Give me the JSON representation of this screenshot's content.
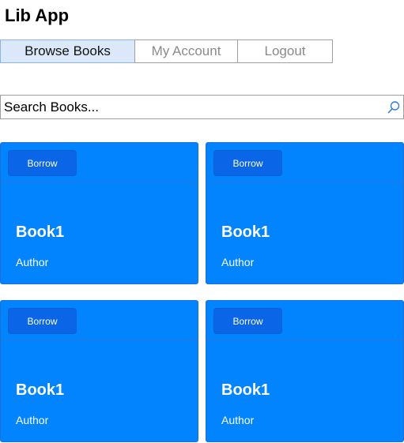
{
  "app": {
    "title": "Lib App"
  },
  "nav": {
    "tabs": [
      {
        "label": "Browse Books",
        "active": true
      },
      {
        "label": "My Account",
        "active": false
      },
      {
        "label": "Logout",
        "active": false
      }
    ]
  },
  "search": {
    "placeholder": "Search Books...",
    "value": "",
    "icon": "search-icon"
  },
  "books": [
    {
      "title": "Book1",
      "author": "Author",
      "action_label": "Borrow"
    },
    {
      "title": "Book1",
      "author": "Author",
      "action_label": "Borrow"
    },
    {
      "title": "Book1",
      "author": "Author",
      "action_label": "Borrow"
    },
    {
      "title": "Book1",
      "author": "Author",
      "action_label": "Borrow"
    }
  ],
  "colors": {
    "card_background": "#0384ff",
    "borrow_button": "#0a66e6",
    "active_tab": "#dbe8f9"
  }
}
